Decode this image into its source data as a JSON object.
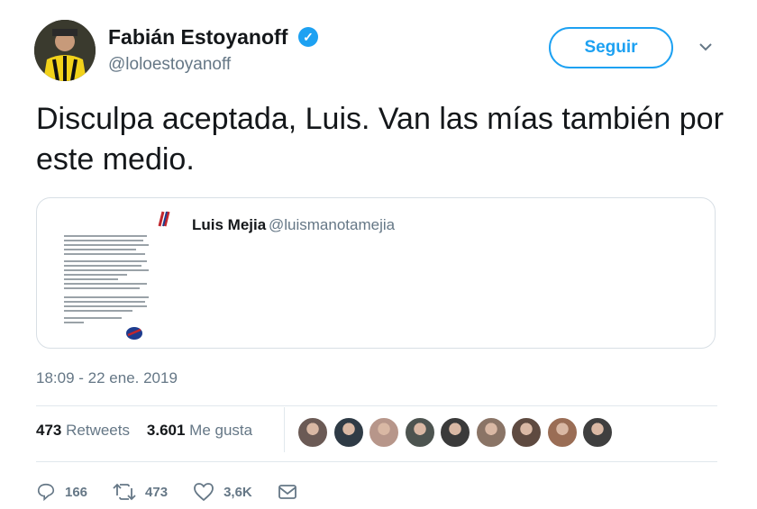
{
  "author": {
    "name": "Fabián Estoyanoff",
    "handle": "@loloestoyanoff",
    "verified": true,
    "avatar_icon": "profile-photo"
  },
  "follow_button": {
    "label": "Seguir"
  },
  "menu": {
    "icon": "chevron-down-icon"
  },
  "tweet": {
    "text": "Disculpa aceptada, Luis. Van las mías también por este medio."
  },
  "quoted_tweet": {
    "name": "Luis Mejia",
    "handle": "@luismanotamejia",
    "media_icon": "document-image"
  },
  "timestamp": "18:09 - 22 ene. 2019",
  "stats": {
    "retweets_count": "473",
    "retweets_label": "Retweets",
    "likes_count": "3.601",
    "likes_label": "Me gusta"
  },
  "liker_avatars": [
    "#6b5a55",
    "#2f3b46",
    "#b7968a",
    "#4d5450",
    "#3a3a3a",
    "#8a7466",
    "#5e4a40",
    "#9a6d55",
    "#3f3f3f"
  ],
  "actions": {
    "reply_count": "166",
    "retweet_count": "473",
    "like_count": "3,6K"
  },
  "colors": {
    "accent": "#1da1f2",
    "secondary_text": "#657786",
    "divider": "#e1e8ed"
  }
}
